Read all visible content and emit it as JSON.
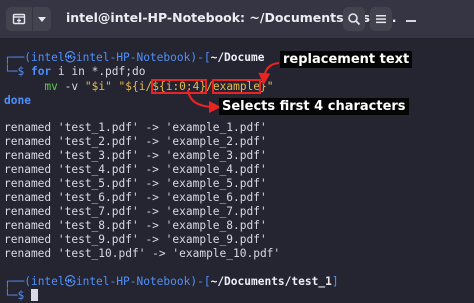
{
  "window": {
    "title": "intel@intel-HP-Notebook: ~/Documents/test_..."
  },
  "icons": {
    "new_tab": "new-tab-icon",
    "menu": "chevron-down-icon",
    "search": "search-icon",
    "hamburger": "hamburger-menu-icon",
    "minimize": "minimize-icon"
  },
  "colors": {
    "prompt_user": "#4f8ff7",
    "prompt_host": "#4f8ff7",
    "prompt_path": "#ececf2",
    "command_keyword": "#4f8ff7",
    "command_string": "#e5b94e",
    "annotation_highlight": "#e82424"
  },
  "terminal": {
    "prompt1": {
      "bracket_open": "┌──(",
      "user": "intel",
      "at": "㉿",
      "host": "intel-HP-Notebook",
      "bracket_mid": ")-[",
      "path": "~/Docume",
      "bracket_close": "",
      "dollar": "└─$ "
    },
    "command_line1": {
      "for": "for",
      "rest": " i in *.pdf;do"
    },
    "command_line2": {
      "indent": "      ",
      "mv": "mv",
      "flags": " -v ",
      "arg1": "\"$i\" ",
      "part_a": "\"${i/",
      "part_b": "${i:0:4}",
      "slash": "/",
      "part_c": "example",
      "part_d": "}\""
    },
    "done": "done",
    "output": [
      "renamed 'test_1.pdf' -> 'example_1.pdf'",
      "renamed 'test_2.pdf' -> 'example_2.pdf'",
      "renamed 'test_3.pdf' -> 'example_3.pdf'",
      "renamed 'test_4.pdf' -> 'example_4.pdf'",
      "renamed 'test_5.pdf' -> 'example_5.pdf'",
      "renamed 'test_6.pdf' -> 'example_6.pdf'",
      "renamed 'test_7.pdf' -> 'example_7.pdf'",
      "renamed 'test_8.pdf' -> 'example_8.pdf'",
      "renamed 'test_9.pdf' -> 'example_9.pdf'",
      "renamed 'test_10.pdf' -> 'example_10.pdf'"
    ],
    "prompt2": {
      "bracket_open": "┌──(",
      "user": "intel",
      "at": "㉿",
      "host": "intel-HP-Notebook",
      "bracket_mid": ")-[",
      "path": "~/Documents/test_1",
      "bracket_close": "]",
      "dollar": "└─$ "
    }
  },
  "annotations": {
    "replacement": "replacement text",
    "selects": "Selects first 4 characters"
  }
}
